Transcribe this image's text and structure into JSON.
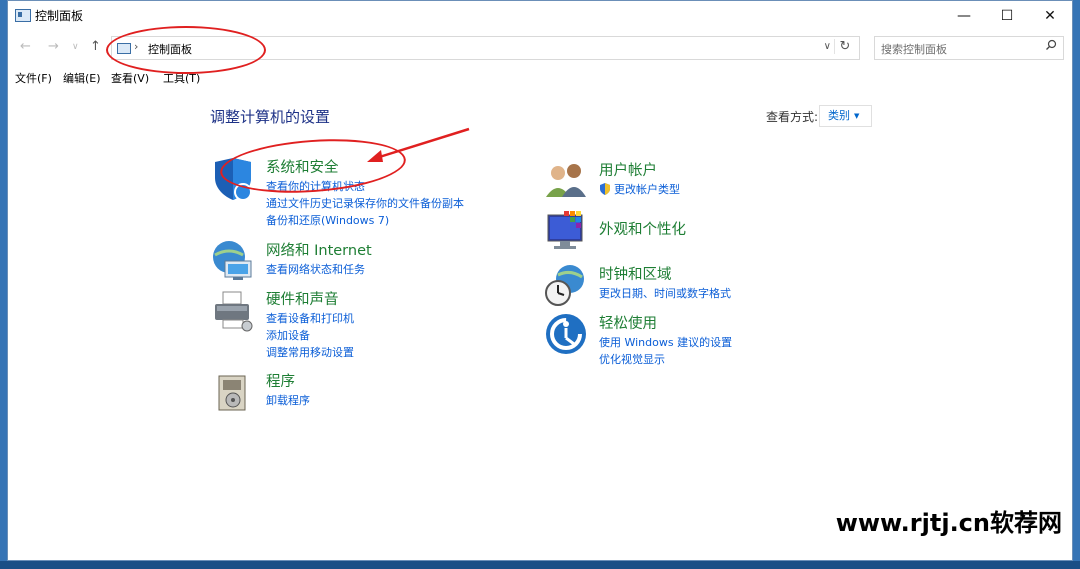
{
  "window": {
    "title": "控制面板",
    "minimize_glyph": "—",
    "maximize_glyph": "☐",
    "close_glyph": "✕"
  },
  "address_bar": {
    "back_glyph": "←",
    "forward_glyph": "→",
    "recent_glyph": "∨",
    "up_glyph": "↑",
    "chevron": "›",
    "path": "控制面板",
    "dropdown_glyph": "∨",
    "refresh_glyph": "↻"
  },
  "search": {
    "placeholder": "搜索控制面板",
    "icon": "search-icon"
  },
  "menu": [
    {
      "label": "文件(F)"
    },
    {
      "label": "编辑(E)"
    },
    {
      "label": "查看(V)"
    },
    {
      "label": "工具(T)"
    }
  ],
  "main": {
    "heading": "调整计算机的设置",
    "view_by_label": "查看方式:",
    "view_by_value": "类别"
  },
  "categories_left": [
    {
      "title": "系统和安全",
      "icon": "security-shield-icon",
      "links": [
        "查看你的计算机状态",
        "通过文件历史记录保存你的文件备份副本",
        "备份和还原(Windows 7)"
      ]
    },
    {
      "title": "网络和 Internet",
      "icon": "network-globe-icon",
      "links": [
        "查看网络状态和任务"
      ]
    },
    {
      "title": "硬件和声音",
      "icon": "printer-icon",
      "links": [
        "查看设备和打印机",
        "添加设备",
        "调整常用移动设置"
      ]
    },
    {
      "title": "程序",
      "icon": "programs-icon",
      "links": [
        "卸载程序"
      ]
    }
  ],
  "categories_right": [
    {
      "title": "用户帐户",
      "icon": "users-icon",
      "links": [
        "更改帐户类型"
      ]
    },
    {
      "title": "外观和个性化",
      "icon": "monitor-palette-icon",
      "links": []
    },
    {
      "title": "时钟和区域",
      "icon": "clock-globe-icon",
      "links": [
        "更改日期、时间或数字格式"
      ]
    },
    {
      "title": "轻松使用",
      "icon": "accessibility-icon",
      "links": [
        "使用 Windows 建议的设置",
        "优化视觉显示"
      ]
    }
  ],
  "watermark": "www.rjtj.cn软荐网",
  "colors": {
    "category_title": "#1e7e34",
    "link": "#0b5ed7",
    "heading": "#1e3287",
    "annotation": "#e02020"
  }
}
